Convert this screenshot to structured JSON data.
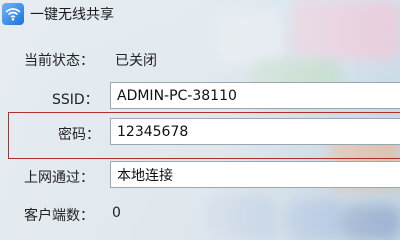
{
  "window": {
    "title": "一键无线共享",
    "icon": "wifi-share-icon"
  },
  "status": {
    "label": "当前状态：",
    "value": "已关闭"
  },
  "ssid": {
    "label": "SSID：",
    "value": "ADMIN-PC-38110"
  },
  "password": {
    "label": "密码：",
    "value": "12345678"
  },
  "network": {
    "label": "上网通过：",
    "value": "本地连接"
  },
  "clients": {
    "label": "客户端数：",
    "value": "0"
  },
  "colors": {
    "highlight": "#b03030"
  }
}
